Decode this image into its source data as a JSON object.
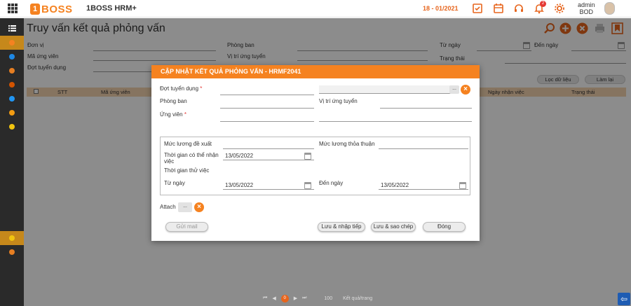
{
  "header": {
    "logo_text": "BOSS",
    "app_title": "1BOSS HRM+",
    "period": "18 - 01/2021",
    "notification_count": "2",
    "user_name": "admin",
    "user_role": "BOD",
    "accent_color": "#f58220"
  },
  "page": {
    "title": "Truy vấn kết quả phỏng vấn"
  },
  "filters": {
    "don_vi": "Đơn vị",
    "ma_ung_vien": "Mã ứng viên",
    "dot_tuyen_dung": "Đợt tuyển dụng",
    "phong_ban": "Phòng ban",
    "vi_tri_ung_tuyen": "Vị trí ứng tuyển",
    "tu_ngay": "Từ ngày",
    "den_ngay": "Đến ngày",
    "trang_thai": "Trạng thái",
    "filter_button": "Lọc dữ liệu",
    "reset_button": "Làm lại"
  },
  "grid": {
    "columns": [
      "STT",
      "Mã ứng viên",
      "Ngày nhận việc",
      "Trạng thái"
    ]
  },
  "pager": {
    "current_page": "0",
    "page_size": "100",
    "page_size_label": "Kết quả/trang"
  },
  "modal": {
    "title": "CẬP NHẬT KẾT QUẢ PHỎNG VẤN - HRMF2041",
    "dot_tuyen_dung_label": "Đợt tuyển dụng",
    "phong_ban_label": "Phòng ban",
    "vi_tri_label": "Vị trí ứng tuyển",
    "ung_vien_label": "Ứng viên",
    "required_mark": "*",
    "muc_luong_de_xuat_label": "Mức lương đề xuất",
    "muc_luong_thoa_thuan_label": "Mức lương thỏa thuận",
    "thoi_gian_nhan_viec_label_1": "Thời gian có thể nhận",
    "thoi_gian_nhan_viec_label_2": "việc",
    "thoi_gian_nhan_viec_value": "13/05/2022",
    "thoi_gian_thu_viec_label": "Thời gian thử việc",
    "tu_ngay_label": "Từ ngày",
    "tu_ngay_value": "13/05/2022",
    "den_ngay_label": "Đến ngày",
    "den_ngay_value": "13/05/2022",
    "attach_label": "Attach",
    "dots_label": "...",
    "send_mail_button": "Gửi mail",
    "save_continue_button": "Lưu & nhập tiếp",
    "save_copy_button": "Lưu & sao chép",
    "close_button": "Đóng"
  }
}
